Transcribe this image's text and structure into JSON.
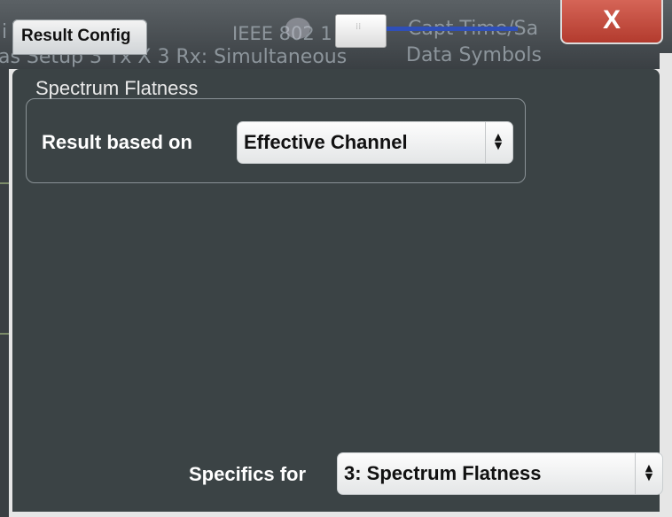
{
  "window": {
    "background_text": {
      "line1_left": "i",
      "line1_standard": "IEEE 802 1",
      "line1_right": "Capt Time/Sa",
      "line2_left": "as Setup  3 Tx X 3 Rx: Simultaneous",
      "line2_right": "Data Symbols"
    }
  },
  "dialog": {
    "title": "Result Config",
    "close_label": "X",
    "group": {
      "title": "Spectrum Flatness",
      "result_based_on_label": "Result based on",
      "result_based_on_value": "Effective Channel"
    },
    "specifics": {
      "label": "Specifics for",
      "value": "3: Spectrum Flatness"
    }
  },
  "icons": {
    "select_arrows": "updown-arrows-icon",
    "close": "close-icon"
  },
  "colors": {
    "dialog_bg": "#3b4345",
    "close_button": "#c24a3c",
    "slider_line": "#2f4fb8"
  }
}
